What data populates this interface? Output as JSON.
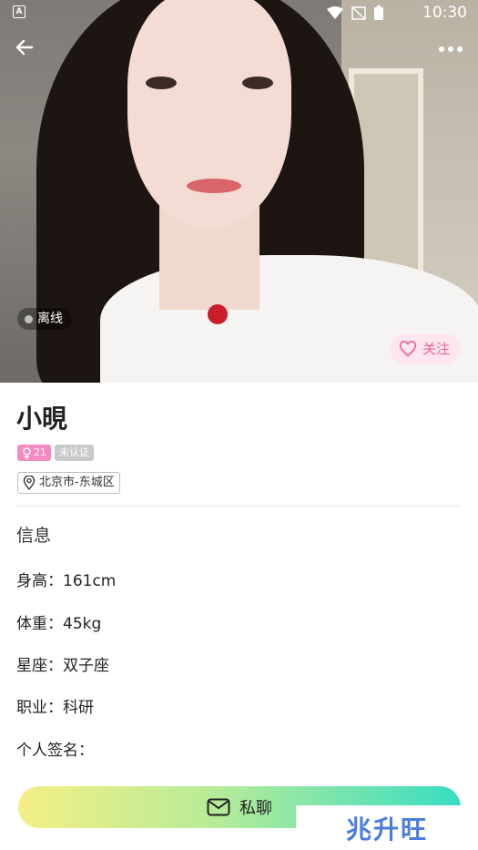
{
  "status_bar": {
    "time": "10:30"
  },
  "profile": {
    "status_label": "离线",
    "follow_label": "关注",
    "name": "小晛",
    "age": "21",
    "verify_label": "未认证",
    "location": "北京市-东城区"
  },
  "info": {
    "title": "信息",
    "rows": [
      "身高：161cm",
      "体重：45kg",
      "星座：双子座",
      "职业：科研",
      "个人签名："
    ]
  },
  "actions": {
    "chat_label": "私聊"
  },
  "watermark": "兆升旺",
  "colors": {
    "accent_pink": "#ef5f9a",
    "gender_badge": "#f58bc0",
    "chat_gradient": [
      "#f4ef86",
      "#b6eb98",
      "#39ddc3"
    ]
  }
}
